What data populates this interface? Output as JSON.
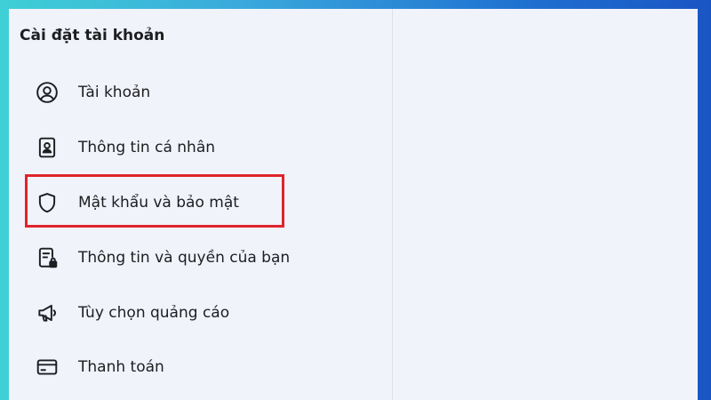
{
  "settings": {
    "title": "Cài đặt tài khoản",
    "items": [
      {
        "label": "Tài khoản",
        "icon": "user-circle-icon"
      },
      {
        "label": "Thông tin cá nhân",
        "icon": "id-card-icon"
      },
      {
        "label": "Mật khẩu và bảo mật",
        "icon": "shield-icon"
      },
      {
        "label": "Thông tin và quyền của bạn",
        "icon": "document-lock-icon"
      },
      {
        "label": "Tùy chọn quảng cáo",
        "icon": "megaphone-icon"
      },
      {
        "label": "Thanh toán",
        "icon": "credit-card-icon"
      }
    ]
  },
  "colors": {
    "highlight": "#e0242b",
    "panel_background": "#f1f3fb",
    "text": "#1c1e21"
  }
}
